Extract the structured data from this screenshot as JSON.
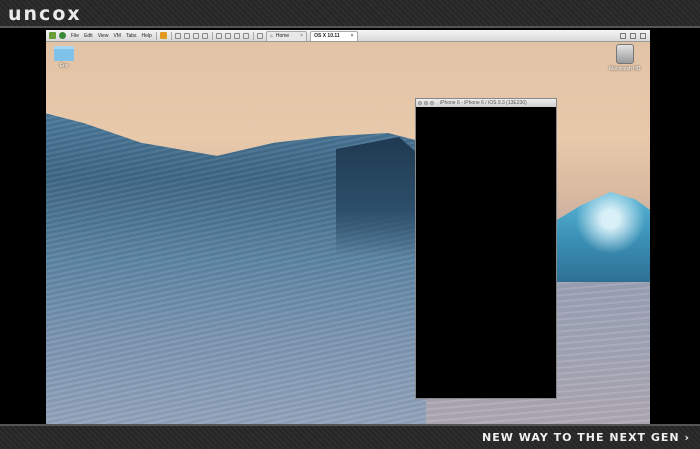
{
  "brand": {
    "logo_text": "UNCOX"
  },
  "footer": {
    "tagline": "NEW WAY TO THE NEXT GEN ›"
  },
  "vm_toolbar": {
    "menus": [
      "File",
      "Edit",
      "View",
      "VM",
      "Tabs",
      "Help"
    ],
    "tabs": [
      {
        "label": "Home",
        "active": false,
        "close": "×"
      },
      {
        "label": "OS X 10.11",
        "active": true,
        "close": "×"
      }
    ]
  },
  "desktop": {
    "icons": [
      {
        "label": "Ens",
        "icon": "folder-icon"
      },
      {
        "label": "Macintosh HD",
        "icon": "hard-drive-icon"
      }
    ]
  },
  "simulator": {
    "title": "iPhone 6 - iPhone 6 / iOS 9.3 (13E230)"
  },
  "colors": {
    "banner_bg": "#2a2a2a",
    "screen_bg": "#000000",
    "folder": "#7fc2ea"
  }
}
